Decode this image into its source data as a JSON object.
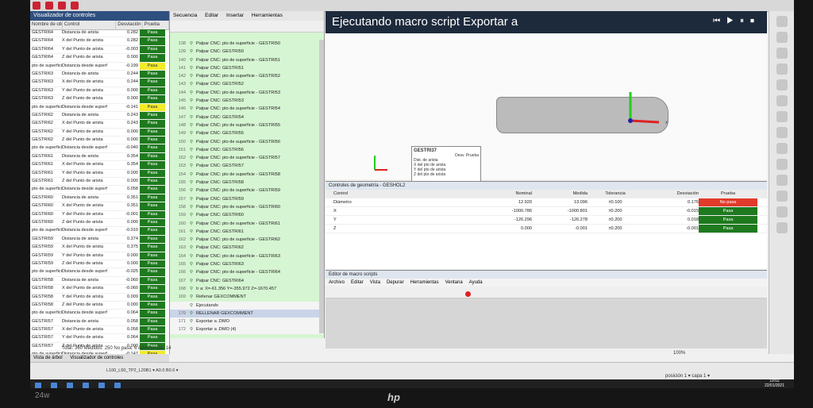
{
  "left_panel": {
    "title": "Visualizador de controles",
    "columns": [
      "Nombre de ob.",
      "Control",
      "Desviación",
      "Prueba"
    ],
    "rows": [
      [
        "GESTRI64",
        "Distancia de arista",
        "0.282",
        "Pasa"
      ],
      [
        "GESTRI64",
        "X del Punto de arista",
        "0.282",
        "Pasa"
      ],
      [
        "GESTRI64",
        "Y del Punto de arista",
        "-0.003",
        "Pasa"
      ],
      [
        "GESTRI64",
        "Z del Punto de arista",
        "0.000",
        "Pasa"
      ],
      [
        "pto de superficie",
        "Distancia desde superf",
        "-0.199",
        "Pasa"
      ],
      [
        "GESTRI63",
        "Distancia de arista",
        "0.244",
        "Pasa"
      ],
      [
        "GESTRI63",
        "X del Punto de arista",
        "0.244",
        "Pasa"
      ],
      [
        "GESTRI63",
        "Y del Punto de arista",
        "0.000",
        "Pasa"
      ],
      [
        "GESTRI63",
        "Z del Punto de arista",
        "0.000",
        "Pasa"
      ],
      [
        "pto de superficie",
        "Distancia desde superf",
        "-0.141",
        "Pasa"
      ],
      [
        "GESTRI62",
        "Distancia de arista",
        "0.243",
        "Pasa"
      ],
      [
        "GESTRI62",
        "X del Punto de arista",
        "0.243",
        "Pasa"
      ],
      [
        "GESTRI62",
        "Y del Punto de arista",
        "0.000",
        "Pasa"
      ],
      [
        "GESTRI62",
        "Z del Punto de arista",
        "0.000",
        "Pasa"
      ],
      [
        "pto de superficie",
        "Distancia desde superf",
        "-0.040",
        "Pasa"
      ],
      [
        "GESTRI61",
        "Distancia de arista",
        "0.354",
        "Pasa"
      ],
      [
        "GESTRI61",
        "X del Punto de arista",
        "0.354",
        "Pasa"
      ],
      [
        "GESTRI61",
        "Y del Punto de arista",
        "0.000",
        "Pasa"
      ],
      [
        "GESTRI61",
        "Z del Punto de arista",
        "0.000",
        "Pasa"
      ],
      [
        "pto de superficie",
        "Distancia desde superf",
        "0.058",
        "Pasa"
      ],
      [
        "GESTRI60",
        "Distancia de arista",
        "0.351",
        "Pasa"
      ],
      [
        "GESTRI60",
        "X del Punto de arista",
        "0.351",
        "Pasa"
      ],
      [
        "GESTRI60",
        "Y del Punto de arista",
        "-0.001",
        "Pasa"
      ],
      [
        "GESTRI60",
        "Z del Punto de arista",
        "0.000",
        "Pasa"
      ],
      [
        "pto de superficie",
        "Distancia desde superf",
        "-0.010",
        "Pasa"
      ],
      [
        "GESTRI59",
        "Distancia de arista",
        "0.374",
        "Pasa"
      ],
      [
        "GESTRI59",
        "X del Punto de arista",
        "0.375",
        "Pasa"
      ],
      [
        "GESTRI59",
        "Y del Punto de arista",
        "0.000",
        "Pasa"
      ],
      [
        "GESTRI59",
        "Z del Punto de arista",
        "0.000",
        "Pasa"
      ],
      [
        "pto de superficie",
        "Distancia desde superf",
        "-0.025",
        "Pasa"
      ],
      [
        "GESTRI58",
        "Distancia de arista",
        "-0.060",
        "Pasa"
      ],
      [
        "GESTRI58",
        "X del Punto de arista",
        "-0.060",
        "Pasa"
      ],
      [
        "GESTRI58",
        "Y del Punto de arista",
        "0.009",
        "Pasa"
      ],
      [
        "GESTRI58",
        "Z del Punto de arista",
        "0.000",
        "Pasa"
      ],
      [
        "pto de superficie",
        "Distancia desde superf",
        "0.064",
        "Pasa"
      ],
      [
        "GESTRI57",
        "Distancia de arista",
        "0.058",
        "Pasa"
      ],
      [
        "GESTRI57",
        "X del Punto de arista",
        "0.058",
        "Pasa"
      ],
      [
        "GESTRI57",
        "Y del Punto de arista",
        "0.064",
        "Pasa"
      ],
      [
        "GESTRI57",
        "Z del Punto de arista",
        "0.000",
        "Pasa"
      ],
      [
        "pto de superficie",
        "Distancia desde superf",
        "-0.147",
        "Pasa"
      ],
      [
        "GESTRI56",
        "Distancia de arista",
        "0.050",
        "Pasa"
      ]
    ],
    "row_status": [
      "pass",
      "pass",
      "pass",
      "pass",
      "warn",
      "pass",
      "pass",
      "pass",
      "pass",
      "warn",
      "pass",
      "pass",
      "pass",
      "pass",
      "pass",
      "pass",
      "pass",
      "pass",
      "pass",
      "pass",
      "pass",
      "pass",
      "pass",
      "pass",
      "pass",
      "pass",
      "pass",
      "pass",
      "pass",
      "pass",
      "pass",
      "pass",
      "pass",
      "pass",
      "pass",
      "pass",
      "pass",
      "pass",
      "pass",
      "warn",
      "pass"
    ],
    "status": "Total: 360   Medidos: 250   No pasa: 6   Advertencia: 14",
    "tabs": [
      "Vista de árbol",
      "Visualizador de controles"
    ],
    "colors": {
      "pass": "#1e7a1e",
      "warn": "#f2ea2a"
    }
  },
  "mid_panel": {
    "tabs": [
      "Secuencia",
      "Editar",
      "Insertar",
      "Herramientas"
    ],
    "title": "secuencia 1",
    "rows": [
      [
        "138",
        "Palpar CNC: pto de superficie - GESTRI50"
      ],
      [
        "139",
        "Palpar CNC: GESTRI50"
      ],
      [
        "140",
        "Palpar CNC: pto de superficie - GESTRI51"
      ],
      [
        "141",
        "Palpar CNC: GESTRI51"
      ],
      [
        "142",
        "Palpar CNC: pto de superficie - GESTRI52"
      ],
      [
        "143",
        "Palpar CNC: GESTRI52"
      ],
      [
        "144",
        "Palpar CNC: pto de superficie - GESTRI53"
      ],
      [
        "145",
        "Palpar CNC: GESTRI53"
      ],
      [
        "146",
        "Palpar CNC: pto de superficie - GESTRI54"
      ],
      [
        "147",
        "Palpar CNC: GESTRI54"
      ],
      [
        "148",
        "Palpar CNC: pto de superficie - GESTRI55"
      ],
      [
        "149",
        "Palpar CNC: GESTRI55"
      ],
      [
        "150",
        "Palpar CNC: pto de superficie - GESTRI56"
      ],
      [
        "151",
        "Palpar CNC: GESTRI56"
      ],
      [
        "152",
        "Palpar CNC: pto de superficie - GESTRI57"
      ],
      [
        "153",
        "Palpar CNC: GESTRI57"
      ],
      [
        "154",
        "Palpar CNC: pto de superficie - GESTRI58"
      ],
      [
        "155",
        "Palpar CNC: GESTRI58"
      ],
      [
        "156",
        "Palpar CNC: pto de superficie - GESTRI59"
      ],
      [
        "157",
        "Palpar CNC: GESTRI59"
      ],
      [
        "158",
        "Palpar CNC: pto de superficie - GESTRI60"
      ],
      [
        "159",
        "Palpar CNC: GESTRI60"
      ],
      [
        "160",
        "Palpar CNC: pto de superficie - GESTRI61"
      ],
      [
        "161",
        "Palpar CNC: GESTRI61"
      ],
      [
        "162",
        "Palpar CNC: pto de superficie - GESTRI62"
      ],
      [
        "163",
        "Palpar CNC: GESTRI62"
      ],
      [
        "164",
        "Palpar CNC: pto de superficie - GESTRI63"
      ],
      [
        "165",
        "Palpar CNC: GESTRI63"
      ],
      [
        "166",
        "Palpar CNC: pto de superficie - GESTRI64"
      ],
      [
        "167",
        "Palpar CNC: GESTRI64"
      ],
      [
        "168",
        "Ir a: X=-61.356 Y=-355.972 Z=-1670.457"
      ],
      [
        "169",
        "Rellenar GEXCOMMENT"
      ],
      [
        "",
        "Ejecutando"
      ],
      [
        "170",
        "RELLENAR GEXCOMMENT"
      ],
      [
        "171",
        "Exportar a .DMO"
      ],
      [
        "172",
        "Exportar a .DMO (4)"
      ]
    ]
  },
  "view": {
    "title": "Ejecutando macro script Exportar a",
    "tooltip_title": "GESTRI37",
    "tooltip_col": "Desv. Prueba",
    "tooltip_lines": [
      "Dist. de arista",
      "X del pto de arista",
      "Y del pto de arista",
      "Z del pto de arista"
    ],
    "axis_x": "x"
  },
  "geometry": {
    "title": "Controles de geometría - GESHOL2",
    "columns": [
      "Control",
      "Nominal",
      "Medida",
      "Tolerancia",
      "Desviación",
      "Prueba"
    ],
    "rows": [
      [
        "Diámetro",
        "12.920",
        "13.096",
        "±0.100",
        "0.176",
        "No pasa"
      ],
      [
        "X",
        "-1000.786",
        "-1000.801",
        "±0.200",
        "-0.015",
        "Pasa"
      ],
      [
        "Y",
        "-126.296",
        "-126.278",
        "±0.200",
        "0.018",
        "Pasa"
      ],
      [
        "Z",
        "0.000",
        "-0.001",
        "±0.200",
        "-0.001",
        "Pasa"
      ]
    ],
    "row_status": [
      "fail",
      "pass",
      "pass",
      "pass"
    ],
    "colors": {
      "fail": "#e23a2a",
      "pass": "#1e7a1e"
    }
  },
  "macro": {
    "title": "Editor de macro scripts",
    "menu": [
      "Archivo",
      "Editar",
      "Vista",
      "Depurar",
      "Herramientas",
      "Ventana",
      "Ayuda"
    ]
  },
  "bottom": {
    "coord": "L100_L50_TP2_L20B1  ▾   A0.0 B0.0  ▾",
    "zoom": "100%",
    "position": "posición 1  ▾    capa 1  ▾"
  },
  "taskbar": {
    "time": "19:02",
    "date": "22/01/2021"
  },
  "bezel": {
    "brand": "hp",
    "model": "24w"
  }
}
